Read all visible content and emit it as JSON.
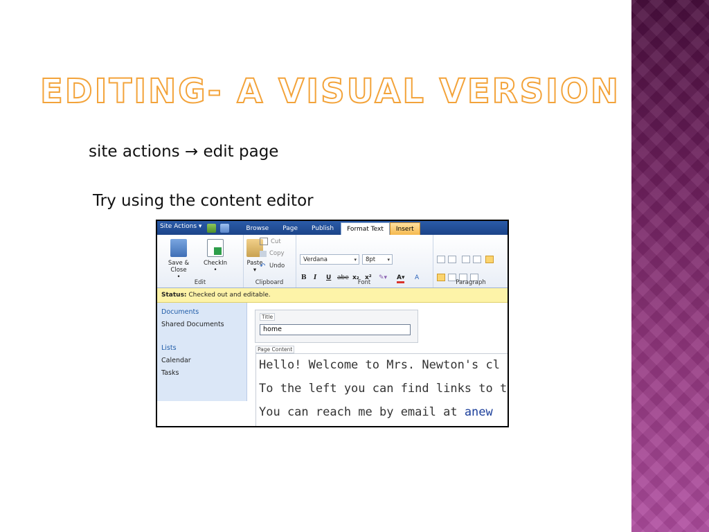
{
  "slide": {
    "title": "Editing- a visual version",
    "line1": "site actions → edit page",
    "line2": "Try using the content editor"
  },
  "colors": {
    "title_outline": "#f3a33a",
    "band_top": "#4a0f3e",
    "band_bottom": "#b04da0",
    "ribbon_blue": "#1c4488",
    "status_bg": "#fdf3a8",
    "nav_bg": "#dbe7f7"
  },
  "screenshot": {
    "topbar": {
      "site_actions": "Site Actions ▾",
      "tabs": [
        "Browse",
        "Page",
        "Publish",
        "Format Text",
        "Insert"
      ],
      "active_tab": "Format Text"
    },
    "ribbon": {
      "edit": {
        "save_close": "Save & Close",
        "checkin": "CheckIn",
        "label": "Edit"
      },
      "clipboard": {
        "paste": "Paste",
        "cut": "Cut",
        "copy": "Copy",
        "undo": "Undo",
        "label": "Clipboard"
      },
      "font": {
        "family": "Verdana",
        "size": "8pt",
        "bold": "B",
        "italic": "I",
        "underline": "U",
        "strike": "abe",
        "subscript": "x₂",
        "superscript": "x²",
        "label": "Font"
      },
      "paragraph": {
        "label": "Paragraph"
      }
    },
    "status": {
      "label": "Status:",
      "text": " Checked out and editable."
    },
    "nav": {
      "documents_head": "Documents",
      "shared_documents": "Shared Documents",
      "lists_head": "Lists",
      "calendar": "Calendar",
      "tasks": "Tasks"
    },
    "editor": {
      "title_label": "Title",
      "title_value": "home",
      "page_content_label": "Page Content",
      "lines": [
        "Hello! Welcome to Mrs. Newton's cl",
        "To the left you can find links to the",
        "You can reach me by email at "
      ],
      "link_fragment": "anew"
    }
  }
}
